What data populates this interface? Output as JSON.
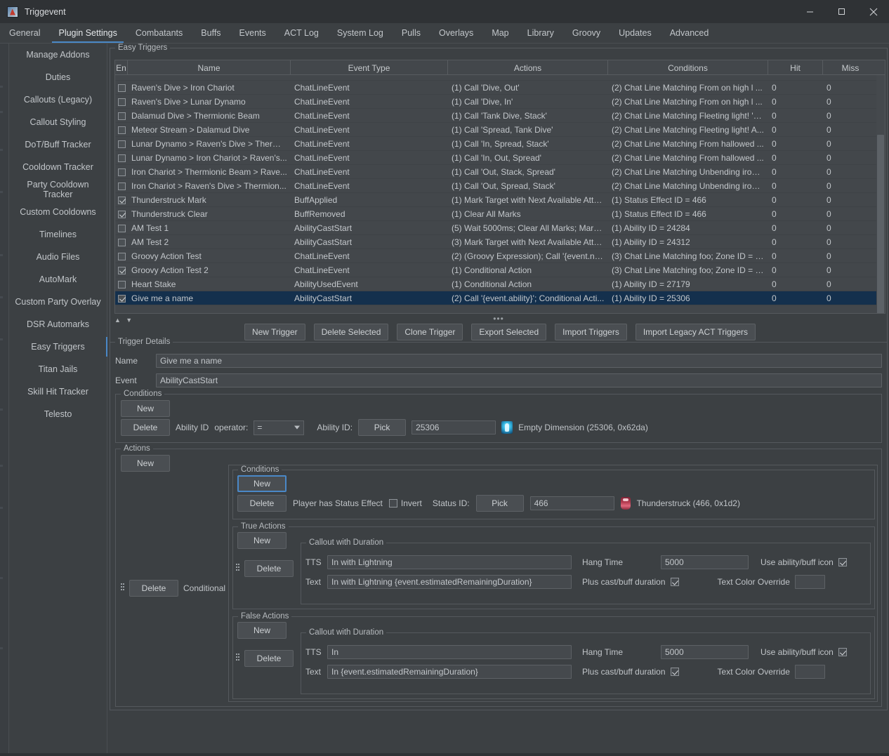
{
  "window": {
    "title": "Triggevent",
    "icon": "app-icon",
    "minimize": "minimize",
    "maximize": "maximize",
    "close": "close"
  },
  "tabs": [
    {
      "label": "General",
      "active": false
    },
    {
      "label": "Plugin Settings",
      "active": true
    },
    {
      "label": "Combatants",
      "active": false
    },
    {
      "label": "Buffs",
      "active": false
    },
    {
      "label": "Events",
      "active": false
    },
    {
      "label": "ACT Log",
      "active": false
    },
    {
      "label": "System Log",
      "active": false
    },
    {
      "label": "Pulls",
      "active": false
    },
    {
      "label": "Overlays",
      "active": false
    },
    {
      "label": "Map",
      "active": false
    },
    {
      "label": "Library",
      "active": false
    },
    {
      "label": "Groovy",
      "active": false
    },
    {
      "label": "Updates",
      "active": false
    },
    {
      "label": "Advanced",
      "active": false
    }
  ],
  "sidebar": {
    "items": [
      {
        "label": "Manage Addons",
        "active": false
      },
      {
        "label": "Duties",
        "active": false
      },
      {
        "label": "Callouts (Legacy)",
        "active": false
      },
      {
        "label": "Callout Styling",
        "active": false
      },
      {
        "label": "DoT/Buff Tracker",
        "active": false
      },
      {
        "label": "Cooldown Tracker",
        "active": false
      },
      {
        "label": "Party Cooldown Tracker",
        "active": false
      },
      {
        "label": "Custom Cooldowns",
        "active": false
      },
      {
        "label": "Timelines",
        "active": false
      },
      {
        "label": "Audio Files",
        "active": false
      },
      {
        "label": "AutoMark",
        "active": false
      },
      {
        "label": "Custom Party Overlay",
        "active": false
      },
      {
        "label": "DSR Automarks",
        "active": false
      },
      {
        "label": "Easy Triggers",
        "active": true
      },
      {
        "label": "Titan Jails",
        "active": false
      },
      {
        "label": "Skill Hit Tracker",
        "active": false
      },
      {
        "label": "Telesto",
        "active": false
      }
    ]
  },
  "easy_triggers": {
    "legend": "Easy Triggers",
    "columns": [
      "En",
      "Name",
      "Event Type",
      "Actions",
      "Conditions",
      "Hit",
      "Miss"
    ],
    "rows": [
      {
        "enabled": false,
        "name": "Raven's Dive > Iron Chariot",
        "event": "ChatLineEvent",
        "actions": "(1) Call 'Dive, Out'",
        "conditions": "(2) Chat Line Matching From on high l ...",
        "hit": "0",
        "miss": "0",
        "selected": false
      },
      {
        "enabled": false,
        "name": "Raven's Dive > Lunar Dynamo",
        "event": "ChatLineEvent",
        "actions": "(1) Call 'Dive, In'",
        "conditions": "(2) Chat Line Matching From on high l ...",
        "hit": "0",
        "miss": "0",
        "selected": false
      },
      {
        "enabled": false,
        "name": "Dalamud Dive > Thermionic Beam",
        "event": "ChatLineEvent",
        "actions": "(1) Call 'Tank Dive, Stack'",
        "conditions": "(2) Chat Line Matching Fleeting light! 'N...",
        "hit": "0",
        "miss": "0",
        "selected": false
      },
      {
        "enabled": false,
        "name": "Meteor Stream > Dalamud Dive",
        "event": "ChatLineEvent",
        "actions": "(1) Call 'Spread, Tank Dive'",
        "conditions": "(2) Chat Line Matching Fleeting light! A...",
        "hit": "0",
        "miss": "0",
        "selected": false
      },
      {
        "enabled": false,
        "name": "Lunar Dynamo > Raven's Dive > Thermi...",
        "event": "ChatLineEvent",
        "actions": "(1) Call 'In, Spread, Stack'",
        "conditions": "(2) Chat Line Matching From hallowed ...",
        "hit": "0",
        "miss": "0",
        "selected": false
      },
      {
        "enabled": false,
        "name": "Lunar Dynamo > Iron Chariot > Raven's...",
        "event": "ChatLineEvent",
        "actions": "(1) Call 'In, Out, Spread'",
        "conditions": "(2) Chat Line Matching From hallowed ...",
        "hit": "0",
        "miss": "0",
        "selected": false
      },
      {
        "enabled": false,
        "name": "Iron Chariot > Thermionic Beam > Rave...",
        "event": "ChatLineEvent",
        "actions": "(1) Call 'Out, Stack, Spread'",
        "conditions": "(2) Chat Line Matching Unbending iron,...",
        "hit": "0",
        "miss": "0",
        "selected": false
      },
      {
        "enabled": false,
        "name": "Iron Chariot > Raven's Dive > Thermion...",
        "event": "ChatLineEvent",
        "actions": "(1) Call 'Out, Spread, Stack'",
        "conditions": "(2) Chat Line Matching Unbending iron,...",
        "hit": "0",
        "miss": "0",
        "selected": false
      },
      {
        "enabled": true,
        "name": "Thunderstruck Mark",
        "event": "BuffApplied",
        "actions": "(1) Mark Target with Next Available Atta...",
        "conditions": "(1) Status Effect ID = 466",
        "hit": "0",
        "miss": "0",
        "selected": false
      },
      {
        "enabled": true,
        "name": "Thunderstruck Clear",
        "event": "BuffRemoved",
        "actions": "(1) Clear All Marks",
        "conditions": "(1) Status Effect ID = 466",
        "hit": "0",
        "miss": "0",
        "selected": false
      },
      {
        "enabled": false,
        "name": "AM Test 1",
        "event": "AbilityCastStart",
        "actions": "(5) Wait 5000ms; Clear All Marks; Mark ...",
        "conditions": "(1) Ability ID = 24284",
        "hit": "0",
        "miss": "0",
        "selected": false
      },
      {
        "enabled": false,
        "name": "AM Test 2",
        "event": "AbilityCastStart",
        "actions": "(3) Mark Target with Next Available Atta...",
        "conditions": "(1) Ability ID = 24312",
        "hit": "0",
        "miss": "0",
        "selected": false
      },
      {
        "enabled": false,
        "name": "Groovy Action Test",
        "event": "ChatLineEvent",
        "actions": "(2) (Groovy Expression); Call '{event.na...",
        "conditions": "(3) Chat Line Matching foo; Zone ID = 3...",
        "hit": "0",
        "miss": "0",
        "selected": false
      },
      {
        "enabled": true,
        "name": "Groovy Action Test 2",
        "event": "ChatLineEvent",
        "actions": "(1) Conditional Action",
        "conditions": "(3) Chat Line Matching foo; Zone ID = 3...",
        "hit": "0",
        "miss": "0",
        "selected": false
      },
      {
        "enabled": false,
        "name": "Heart Stake",
        "event": "AbilityUsedEvent",
        "actions": "(1) Conditional Action",
        "conditions": "(1) Ability ID = 27179",
        "hit": "0",
        "miss": "0",
        "selected": false
      },
      {
        "enabled": true,
        "name": "Give me a name",
        "event": "AbilityCastStart",
        "actions": "(2) Call '{event.ability}'; Conditional Acti...",
        "conditions": "(1) Ability ID = 25306",
        "hit": "0",
        "miss": "0",
        "selected": true
      }
    ],
    "sort_up": "▲",
    "sort_down": "▼",
    "overflow_dots": "•••"
  },
  "toolbar": {
    "new_trigger": "New Trigger",
    "delete_selected": "Delete Selected",
    "clone_trigger": "Clone Trigger",
    "export_selected": "Export Selected",
    "import_triggers": "Import Triggers",
    "import_legacy": "Import Legacy ACT Triggers"
  },
  "trigger_details": {
    "legend": "Trigger Details",
    "name_label": "Name",
    "name_value": "Give me a name",
    "event_label": "Event",
    "event_value": "AbilityCastStart",
    "conditions": {
      "legend": "Conditions",
      "new_label": "New",
      "delete_label": "Delete",
      "row_label": "Ability ID",
      "operator_label": "operator:",
      "operator_value": "=",
      "ability_id_label": "Ability ID:",
      "pick_label": "Pick",
      "ability_id_value": "25306",
      "resolved_icon": "ability-icon",
      "resolved_text": "Empty Dimension (25306, 0x62da)"
    },
    "actions": {
      "legend": "Actions",
      "new_label": "New",
      "conditional": {
        "delete_label": "Delete",
        "type_label": "Conditional",
        "drag_handle": "drag-handle",
        "conditions": {
          "legend": "Conditions",
          "new_label": "New",
          "delete_label": "Delete",
          "row_label": "Player has Status Effect",
          "invert_label": "Invert",
          "invert_checked": false,
          "status_id_label": "Status ID:",
          "pick_label": "Pick",
          "status_id_value": "466",
          "resolved_icon": "status-icon",
          "resolved_text": "Thunderstruck (466, 0x1d2)"
        },
        "true_actions": {
          "legend": "True Actions",
          "new_label": "New",
          "delete_label": "Delete",
          "drag_handle": "drag-handle",
          "callout": {
            "legend": "Callout with Duration",
            "tts_label": "TTS",
            "tts_value": "In with Lightning",
            "text_label": "Text",
            "text_value": "In with Lightning {event.estimatedRemainingDuration}",
            "hang_time_label": "Hang Time",
            "hang_time_value": "5000",
            "plus_duration_label": "Plus cast/buff duration",
            "plus_duration_checked": true,
            "use_icon_label": "Use ability/buff icon",
            "use_icon_checked": true,
            "color_override_label": "Text Color Override",
            "color_override_value": ""
          }
        },
        "false_actions": {
          "legend": "False Actions",
          "new_label": "New",
          "delete_label": "Delete",
          "drag_handle": "drag-handle",
          "callout": {
            "legend": "Callout with Duration",
            "tts_label": "TTS",
            "tts_value": "In",
            "text_label": "Text",
            "text_value": "In {event.estimatedRemainingDuration}",
            "hang_time_label": "Hang Time",
            "hang_time_value": "5000",
            "plus_duration_label": "Plus cast/buff duration",
            "plus_duration_checked": true,
            "use_icon_label": "Use ability/buff icon",
            "use_icon_checked": true,
            "color_override_label": "Text Color Override",
            "color_override_value": ""
          }
        }
      }
    }
  },
  "colors": {
    "window_bg": "#3c4043",
    "titlebar_bg": "#2f3235",
    "accent": "#4a88c7",
    "selection": "#14304d",
    "text": "#c3c7cb",
    "border": "#55595d"
  }
}
